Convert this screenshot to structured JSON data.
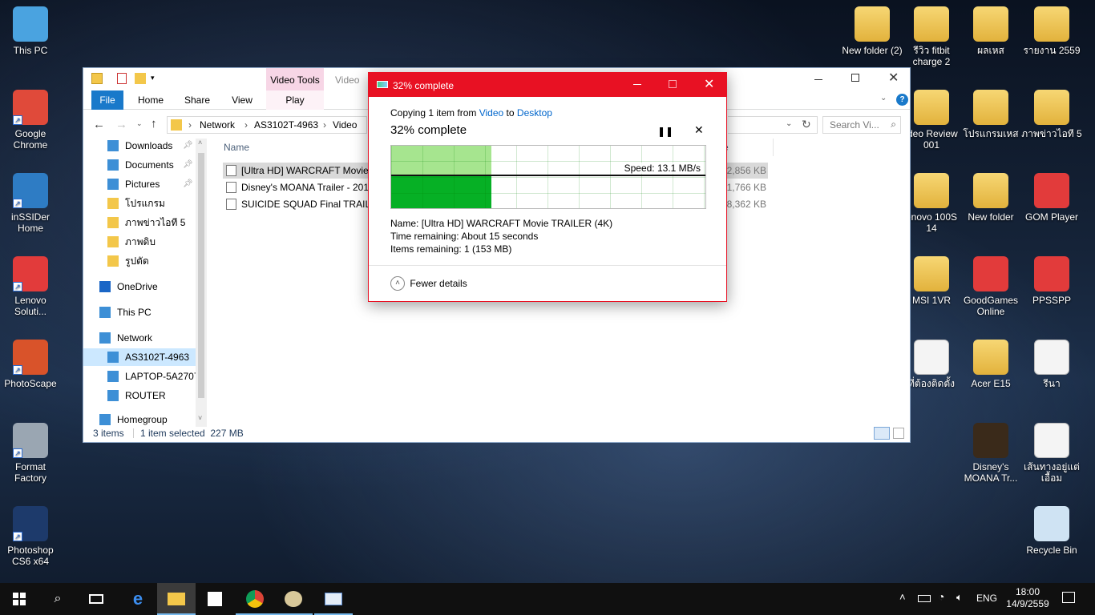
{
  "desktop_left": [
    {
      "label": "This PC",
      "icon": "this-pc-icon",
      "color": "#4aa3e0"
    },
    {
      "label": "Google Chrome",
      "icon": "chrome-icon",
      "color": "#e04a3a"
    },
    {
      "label": "inSSIDer Home",
      "icon": "inssider-icon",
      "color": "#2e7cc4"
    },
    {
      "label": "Lenovo Soluti...",
      "icon": "lenovo-solution-icon",
      "color": "#e23b3b"
    },
    {
      "label": "PhotoScape",
      "icon": "photoscape-icon",
      "color": "#d9532a"
    },
    {
      "label": "Format Factory",
      "icon": "format-factory-icon",
      "color": "#9aa6b2"
    },
    {
      "label": "Photoshop CS6 x64",
      "icon": "photoshop-icon",
      "color": "#1d3a6b"
    }
  ],
  "desktop_right": [
    {
      "label": "New folder (2)",
      "icon": "folder-icon",
      "type": "folder"
    },
    {
      "label": "รีวิว fitbit charge 2",
      "icon": "folder-icon",
      "type": "folder"
    },
    {
      "label": "ผลเหส",
      "icon": "folder-icon",
      "type": "folder"
    },
    {
      "label": "รายงาน 2559",
      "icon": "folder-icon",
      "type": "folder"
    },
    {
      "label": "ideo Review 001",
      "icon": "folder-icon",
      "type": "folder"
    },
    {
      "label": "โปรแกรมเหส",
      "icon": "folder-icon",
      "type": "folder"
    },
    {
      "label": "ภาพข่าวไอที 5",
      "icon": "folder-icon",
      "type": "folder"
    },
    {
      "label": "enovo 100S 14",
      "icon": "folder-icon",
      "type": "folder"
    },
    {
      "label": "New folder",
      "icon": "folder-icon",
      "type": "folder"
    },
    {
      "label": "GOM Player",
      "icon": "gom-player-icon",
      "type": "app"
    },
    {
      "label": "MSI 1VR",
      "icon": "folder-icon",
      "type": "folder"
    },
    {
      "label": "GoodGames Online",
      "icon": "goodgames-icon",
      "type": "app"
    },
    {
      "label": "PPSSPP",
      "icon": "ppsspp-icon",
      "type": "app"
    },
    {
      "label": "ที่ต้องติดตั้ง",
      "icon": "document-icon",
      "type": "doc"
    },
    {
      "label": "Acer E15",
      "icon": "folder-icon",
      "type": "folder"
    },
    {
      "label": "รีนา",
      "icon": "document-icon",
      "type": "doc"
    },
    {
      "label": "Disney's MOANA Tr...",
      "icon": "video-file-icon",
      "type": "video"
    },
    {
      "label": "เส้นทางอยู่แต่ เอื้อม",
      "icon": "word-document-icon",
      "type": "doc"
    },
    {
      "label": "Recycle Bin",
      "icon": "recycle-bin-icon",
      "type": "bin"
    }
  ],
  "explorer": {
    "contextual_tab": "Video Tools",
    "title_partial": "Video",
    "tabs": [
      "File",
      "Home",
      "Share",
      "View",
      "Play"
    ],
    "breadcrumb": [
      "Network",
      "AS3102T-4963",
      "Video"
    ],
    "search_placeholder": "Search Vi...",
    "nav_items": [
      {
        "label": "Downloads",
        "icon": "downloads-icon",
        "pinned": true
      },
      {
        "label": "Documents",
        "icon": "documents-icon",
        "pinned": true
      },
      {
        "label": "Pictures",
        "icon": "pictures-icon",
        "pinned": true
      },
      {
        "label": "โปรแกรม",
        "icon": "folder-icon",
        "pinned": false
      },
      {
        "label": "ภาพข่าวไอที 5",
        "icon": "folder-icon",
        "pinned": false
      },
      {
        "label": "ภาพดิบ",
        "icon": "folder-icon",
        "pinned": false
      },
      {
        "label": "รูปตัด",
        "icon": "folder-icon",
        "pinned": false
      },
      {
        "label": "OneDrive",
        "icon": "onedrive-icon",
        "pinned": false
      },
      {
        "label": "This PC",
        "icon": "this-pc-icon",
        "pinned": false
      },
      {
        "label": "Network",
        "icon": "network-icon",
        "pinned": false
      },
      {
        "label": "AS3102T-4963",
        "icon": "computer-icon",
        "pinned": false
      },
      {
        "label": "LAPTOP-5A2707",
        "icon": "computer-icon",
        "pinned": false
      },
      {
        "label": "ROUTER",
        "icon": "computer-icon",
        "pinned": false
      },
      {
        "label": "Homegroup",
        "icon": "homegroup-icon",
        "pinned": false
      }
    ],
    "column_name": "Name",
    "column_size": "e",
    "files": [
      {
        "name": "[Ultra HD] WARCRAFT Movie T",
        "size": "32,856 KB",
        "selected": true
      },
      {
        "name": "Disney's MOANA Trailer - 2016",
        "size": "21,766 KB",
        "selected": false
      },
      {
        "name": "SUICIDE SQUAD Final TRAILER",
        "size": "18,362 KB",
        "selected": false
      }
    ],
    "status_items": "3 items",
    "status_selected": "1 item selected  227 MB"
  },
  "dialog": {
    "title": "32% complete",
    "copy_prefix": "Copying 1 item from",
    "source": "Video",
    "to_word": "to",
    "dest": "Desktop",
    "heading": "32% complete",
    "progress": 0.32,
    "speed": "Speed: 13.1 MB/s",
    "name_label": "Name:",
    "name_value": "[Ultra HD] WARCRAFT Movie TRAILER (4K)",
    "time_label": "Time remaining:",
    "time_value": "About 15 seconds",
    "items_label": "Items remaining:",
    "items_value": "1 (153 MB)",
    "fewer_details": "Fewer details"
  },
  "taskbar": {
    "lang": "ENG",
    "time": "18:00",
    "date": "14/9/2559"
  },
  "colors": {
    "accent": "#0078d7",
    "alert": "#e81123",
    "progress": "#06b025",
    "progress_light": "#a6e58f"
  }
}
